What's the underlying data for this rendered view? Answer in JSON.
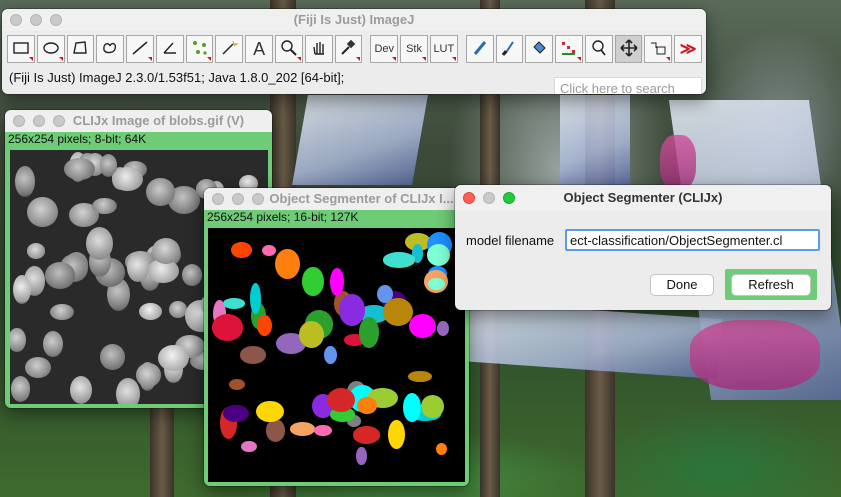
{
  "imagej": {
    "title": "(Fiji Is Just) ImageJ",
    "status": "(Fiji Is Just) ImageJ 2.3.0/1.53f51; Java 1.8.0_202 [64-bit];",
    "search_placeholder": "Click here to search",
    "tools": [
      {
        "name": "rectangle-tool",
        "icon": "rectangle-icon"
      },
      {
        "name": "oval-tool",
        "icon": "oval-icon"
      },
      {
        "name": "polygon-tool",
        "icon": "polygon-icon"
      },
      {
        "name": "freehand-tool",
        "icon": "freehand-icon"
      },
      {
        "name": "line-tool",
        "icon": "line-icon"
      },
      {
        "name": "angle-tool",
        "icon": "angle-icon"
      },
      {
        "name": "multipoint-tool",
        "icon": "multipoint-icon"
      },
      {
        "name": "wand-tool",
        "icon": "wand-icon"
      },
      {
        "name": "text-tool",
        "icon": "text-icon",
        "label": "A"
      },
      {
        "name": "magnifier-tool",
        "icon": "magnifier-icon"
      },
      {
        "name": "hand-tool",
        "icon": "hand-icon"
      },
      {
        "name": "color-picker-tool",
        "icon": "dropper-icon"
      },
      {
        "name": "dev-tool",
        "icon": "dev-menu-icon",
        "label": "Dev"
      },
      {
        "name": "stk-tool",
        "icon": "stack-menu-icon",
        "label": "Stk"
      },
      {
        "name": "lut-tool",
        "icon": "lut-menu-icon",
        "label": "LUT"
      },
      {
        "name": "pencil-tool",
        "icon": "pencil-icon"
      },
      {
        "name": "brush-tool",
        "icon": "brush-icon"
      },
      {
        "name": "flood-fill-tool",
        "icon": "bucket-icon"
      },
      {
        "name": "clij-tool",
        "icon": "clij-icon"
      },
      {
        "name": "search-tool",
        "icon": "search-icon"
      },
      {
        "name": "move-tool",
        "icon": "move-arrows-icon"
      },
      {
        "name": "action-tool",
        "icon": "action-icon"
      },
      {
        "name": "more-tools",
        "icon": "double-chevron-icon",
        "label": "≫"
      }
    ]
  },
  "blobs_window": {
    "title": "CLIJx Image of blobs.gif (V)",
    "info": "256x254 pixels; 8-bit; 64K"
  },
  "segmenter_window": {
    "title": "Object Segmenter of CLIJx I...",
    "info": "256x254 pixels; 16-bit; 127K"
  },
  "dialog": {
    "title": "Object Segmenter (CLIJx)",
    "field_label": "model filename",
    "field_value": "ect-classification/ObjectSegmenter.cl",
    "done_label": "Done",
    "refresh_label": "Refresh"
  },
  "colors": {
    "accent_green": "#6ecb76",
    "focus_blue": "#5b9ce8",
    "toolbar_arrow": "#d0141e"
  }
}
